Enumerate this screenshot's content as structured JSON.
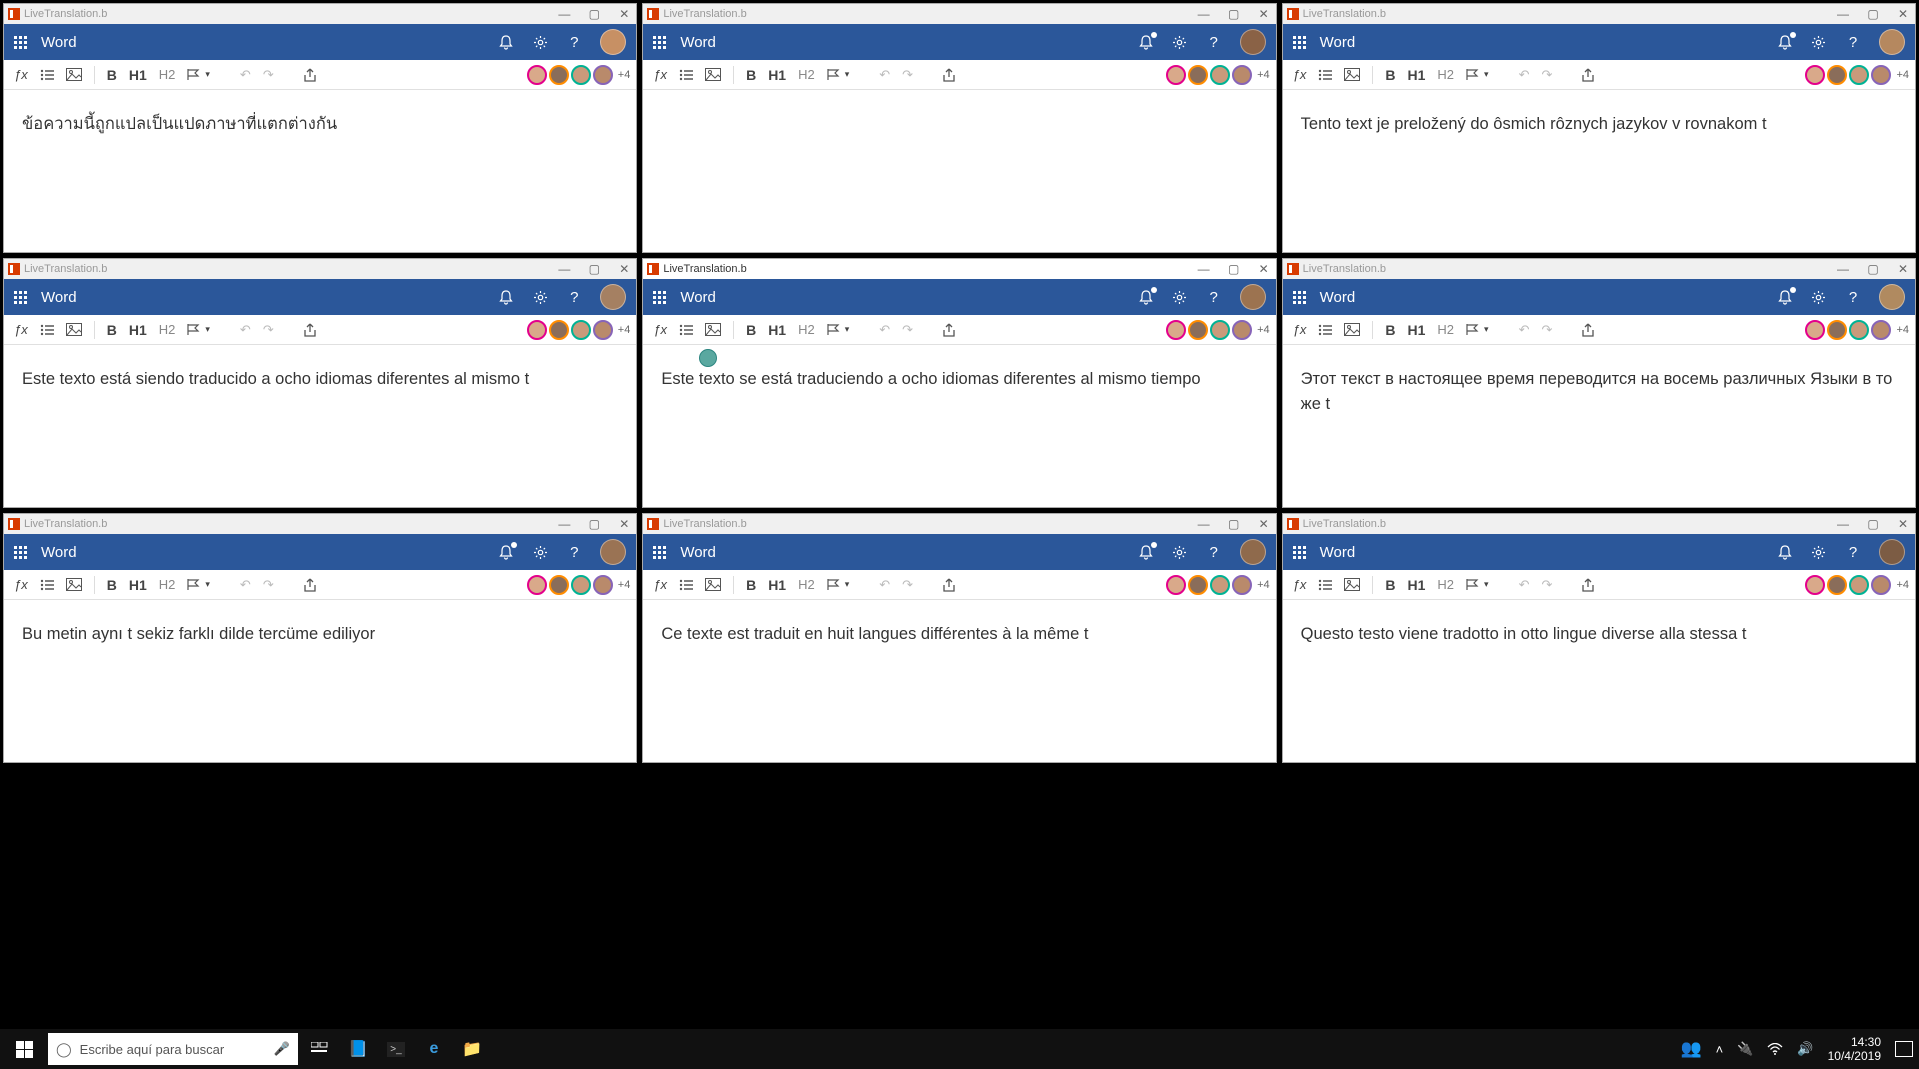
{
  "window_title": "LiveTranslation.b",
  "app_name": "Word",
  "toolbar": {
    "bold": "B",
    "h1": "H1",
    "h2": "H2",
    "plus": "+4"
  },
  "windows": [
    {
      "text": "ข้อความนี้ถูกแปลเป็นแปดภาษาที่แตกต่างกัน",
      "active": false,
      "avatar": "#c79064",
      "notif": false
    },
    {
      "text": "",
      "active": false,
      "avatar": "#8a6246",
      "notif": true
    },
    {
      "text": "Tento text je preložený do ôsmich rôznych jazykov v rovnakom t",
      "active": false,
      "avatar": "#b5885f",
      "notif": true
    },
    {
      "text": "Este texto está siendo traducido a ocho idiomas diferentes al mismo t",
      "active": false,
      "avatar": "#a58062",
      "notif": false
    },
    {
      "text": "Este texto se está traduciendo a ocho idiomas diferentes al mismo tiempo",
      "active": true,
      "avatar": "#9c7350",
      "notif": true,
      "cursor": true
    },
    {
      "text": "Этот текст в настоящее время переводится на восемь различных Языки в то же t",
      "active": false,
      "avatar": "#b08a60",
      "notif": true
    },
    {
      "text": "Bu metin aynı t sekiz farklı dilde tercüme ediliyor",
      "active": false,
      "avatar": "#9a7354",
      "notif": true
    },
    {
      "text": "Ce texte est traduit en huit langues différentes à la même t",
      "active": false,
      "avatar": "#8f6a4c",
      "notif": true
    },
    {
      "text": "Questo testo viene tradotto in otto lingue diverse alla stessa t",
      "active": false,
      "avatar": "#7c5c44",
      "notif": false
    }
  ],
  "taskbar": {
    "search_placeholder": "Escribe aquí para buscar",
    "time": "14:30",
    "date": "10/4/2019"
  }
}
